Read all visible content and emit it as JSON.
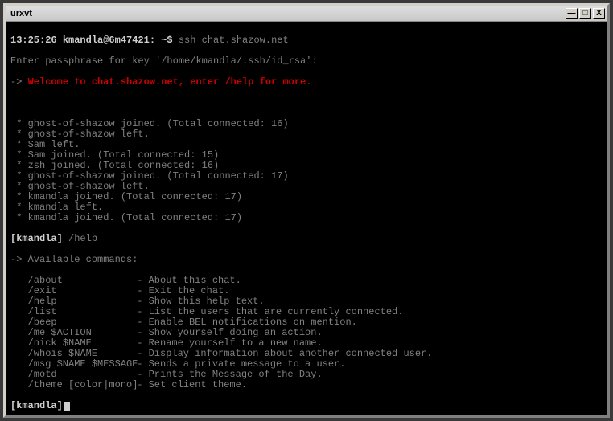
{
  "window": {
    "title": "urxvt",
    "buttons": {
      "minimize": "—",
      "maximize": "□",
      "close": "X"
    }
  },
  "prompt": {
    "timestamp": "13:25:26",
    "userhost": "kmandla@6m47421: ~$",
    "command": "ssh chat.shazow.net",
    "passphrase_line": "Enter passphrase for key '/home/kmandla/.ssh/id_rsa':",
    "welcome": "Welcome to chat.shazow.net, enter /help for more."
  },
  "events": [
    " * ghost-of-shazow joined. (Total connected: 16)",
    " * ghost-of-shazow left.",
    " * Sam left.",
    " * Sam joined. (Total connected: 15)",
    " * zsh joined. (Total connected: 16)",
    " * ghost-of-shazow joined. (Total connected: 17)",
    " * ghost-of-shazow left.",
    " * kmandla joined. (Total connected: 17)",
    " * kmandla left.",
    " * kmandla joined. (Total connected: 17)"
  ],
  "input_line": {
    "user": "[kmandla]",
    "typed": "/help"
  },
  "help": {
    "header": "Available commands:",
    "rows": [
      {
        "cmd": "/about",
        "desc": "- About this chat."
      },
      {
        "cmd": "/exit",
        "desc": "- Exit the chat."
      },
      {
        "cmd": "/help",
        "desc": "- Show this help text."
      },
      {
        "cmd": "/list",
        "desc": "- List the users that are currently connected."
      },
      {
        "cmd": "/beep",
        "desc": "- Enable BEL notifications on mention."
      },
      {
        "cmd": "/me $ACTION",
        "desc": "- Show yourself doing an action."
      },
      {
        "cmd": "/nick $NAME",
        "desc": "- Rename yourself to a new name."
      },
      {
        "cmd": "/whois $NAME",
        "desc": "- Display information about another connected user."
      },
      {
        "cmd": "/msg $NAME $MESSAGE",
        "desc": "- Sends a private message to a user."
      },
      {
        "cmd": "/motd",
        "desc": "- Prints the Message of the Day."
      },
      {
        "cmd": "/theme [color|mono]",
        "desc": "- Set client theme."
      }
    ]
  },
  "bottom_prompt": "[kmandla]"
}
